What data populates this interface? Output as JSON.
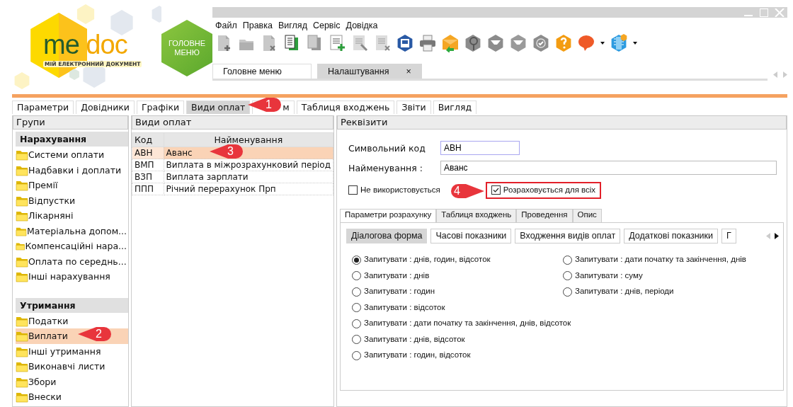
{
  "logo": {
    "brand_left": "me",
    "brand_right": "doc",
    "tagline": "МІЙ ЕЛЕКТРОННИЙ ДОКУМЕНТ"
  },
  "main_menu_button": {
    "label": "ГОЛОВНЕ МЕНЮ"
  },
  "menu": [
    "Файл",
    "Правка",
    "Вигляд",
    "Сервіс",
    "Довідка"
  ],
  "doc_tabs": [
    {
      "label": "Головне меню",
      "selected": false
    },
    {
      "label": "Налаштування",
      "selected": true,
      "close": "×"
    }
  ],
  "module_tabs": [
    {
      "label": "Параметри",
      "selected": false
    },
    {
      "label": "Довідники",
      "selected": false
    },
    {
      "label": "Графіки",
      "selected": false
    },
    {
      "label": "Види оплат",
      "selected": true
    },
    {
      "label": "м",
      "selected": false,
      "covered": true
    },
    {
      "label": "Таблиця входжень",
      "selected": false
    },
    {
      "label": "Звіти",
      "selected": false
    },
    {
      "label": "Вигляд",
      "selected": false
    }
  ],
  "groups_panel": {
    "title": "Групи",
    "sections": [
      {
        "title": "Нарахування",
        "items": [
          {
            "label": "Системи оплати",
            "selected": false
          },
          {
            "label": "Надбавки і доплати",
            "selected": false
          },
          {
            "label": "Премії",
            "selected": false
          },
          {
            "label": "Відпустки",
            "selected": false
          },
          {
            "label": "Лікарняні",
            "selected": false
          },
          {
            "label": "Матеріальна допом...",
            "selected": false
          },
          {
            "label": "Компенсаційні нара...",
            "selected": false
          },
          {
            "label": "Оплата по середнь...",
            "selected": false
          },
          {
            "label": "Інші нарахування",
            "selected": false
          }
        ]
      },
      {
        "title": "Утримання",
        "items": [
          {
            "label": "Податки",
            "selected": false
          },
          {
            "label": "Виплати",
            "selected": true
          },
          {
            "label": "Інші утримання",
            "selected": false
          },
          {
            "label": "Виконавчі листи",
            "selected": false
          },
          {
            "label": "Збори",
            "selected": false
          },
          {
            "label": "Внески",
            "selected": false
          }
        ]
      }
    ]
  },
  "payments_panel": {
    "title": "Види оплат",
    "columns": [
      "Код",
      "Найменування"
    ],
    "rows": [
      {
        "code": "АВН",
        "name": "Аванс",
        "selected": true
      },
      {
        "code": "ВМП",
        "name": "Виплата в міжрозрахунковий період",
        "selected": false
      },
      {
        "code": "ВЗП",
        "name": "Виплата зарплати",
        "selected": false
      },
      {
        "code": "ППП",
        "name": "Річний перерахунок Прп",
        "selected": false
      }
    ]
  },
  "details_panel": {
    "title": "Реквізити",
    "fields": [
      {
        "label": "Символьний код",
        "value": "АВН",
        "focused": true
      },
      {
        "label": "Найменування :",
        "value": "Аванс",
        "focused": false
      }
    ],
    "checkboxes": [
      {
        "label": "Не використовується",
        "checked": false,
        "highlighted": false
      },
      {
        "label": "Розраховується для всіх",
        "checked": true,
        "highlighted": true
      }
    ],
    "tabs": [
      {
        "label": "Параметри розрахунку",
        "selected": true
      },
      {
        "label": "Таблиця входжень",
        "selected": false
      },
      {
        "label": "Проведення",
        "selected": false
      },
      {
        "label": "Опис",
        "selected": false
      }
    ],
    "subtabs": [
      {
        "label": "Діалогова форма",
        "selected": true
      },
      {
        "label": "Часові показники",
        "selected": false
      },
      {
        "label": "Входження видів оплат",
        "selected": false
      },
      {
        "label": "Додаткові показники",
        "selected": false
      },
      {
        "label": "Г",
        "selected": false
      }
    ],
    "option_columns": [
      [
        {
          "label": "Запитувати : днів, годин, відсоток",
          "selected": true
        },
        {
          "label": "Запитувати : днів",
          "selected": false
        },
        {
          "label": "Запитувати : годин",
          "selected": false
        },
        {
          "label": "Запитувати : відсоток",
          "selected": false
        },
        {
          "label": "Запитувати : дати початку та закінчення, днів, відсоток",
          "selected": false
        },
        {
          "label": "Запитувати : днів, відсоток",
          "selected": false
        },
        {
          "label": "Запитувати : годин, відсоток",
          "selected": false
        }
      ],
      [
        {
          "label": "Запитувати : дати початку та закінчення, днів",
          "selected": false
        },
        {
          "label": "Запитувати : суму",
          "selected": false
        },
        {
          "label": "Запитувати : днів, періоди",
          "selected": false
        }
      ]
    ]
  },
  "callouts": [
    {
      "number": "1",
      "kind": "left"
    },
    {
      "number": "2",
      "kind": "left"
    },
    {
      "number": "3",
      "kind": "left"
    },
    {
      "number": "4",
      "kind": "right"
    }
  ]
}
